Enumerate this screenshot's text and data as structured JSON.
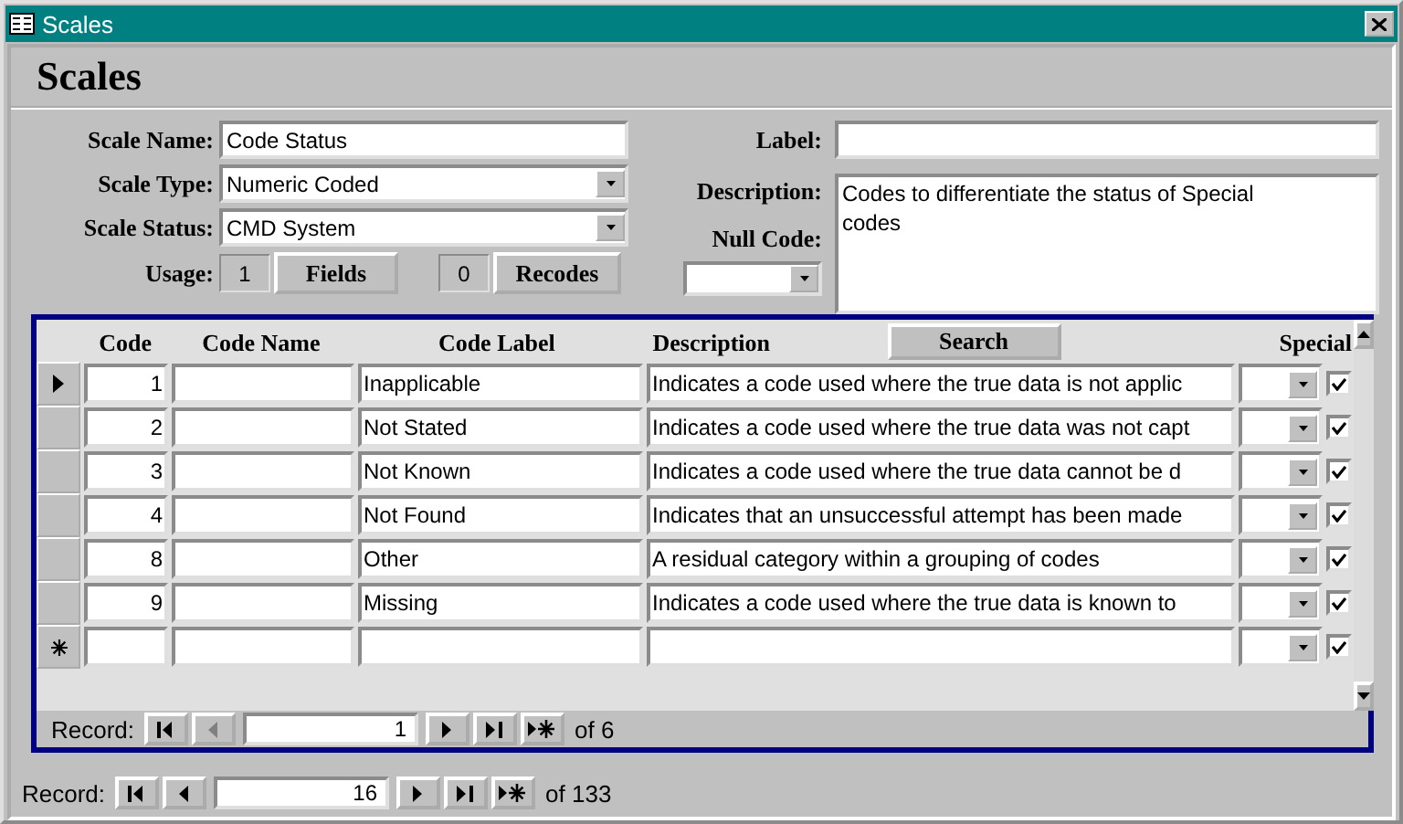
{
  "window": {
    "title": "Scales"
  },
  "header": {
    "title": "Scales"
  },
  "form": {
    "scale_name": {
      "label": "Scale Name:",
      "value": "Code Status"
    },
    "scale_type": {
      "label": "Scale Type:",
      "value": "Numeric Coded"
    },
    "scale_status": {
      "label": "Scale Status:",
      "value": "CMD System"
    },
    "usage": {
      "label": "Usage:",
      "fields_count": "1",
      "fields_button": "Fields",
      "recodes_count": "0",
      "recodes_button": "Recodes"
    },
    "label": {
      "label": "Label:"
    },
    "description": {
      "label": "Description:",
      "value": "Codes to differentiate the status of Special codes"
    },
    "null_code": {
      "label": "Null Code:"
    }
  },
  "subform": {
    "columns": [
      "Code",
      "Code Name",
      "Code Label",
      "Description",
      "Special"
    ],
    "search_button": "Search",
    "rows": [
      {
        "selected": true,
        "code": "1",
        "code_label": "Inapplicable",
        "description": "Indicates a code used where the true data is not applic",
        "special": true
      },
      {
        "selected": false,
        "code": "2",
        "code_label": "Not Stated",
        "description": "Indicates a code used where the true data was not capt",
        "special": true
      },
      {
        "selected": false,
        "code": "3",
        "code_label": "Not Known",
        "description": "Indicates a code used where the true data cannot be d",
        "special": true
      },
      {
        "selected": false,
        "code": "4",
        "code_label": "Not Found",
        "description": "Indicates that an unsuccessful attempt has been made",
        "special": true
      },
      {
        "selected": false,
        "code": "8",
        "code_label": "Other",
        "description": "A residual category within a grouping of codes",
        "special": true
      },
      {
        "selected": false,
        "code": "9",
        "code_label": "Missing",
        "description": "Indicates a code used where the true data is known to",
        "special": true
      }
    ],
    "new_row": {
      "special": true
    },
    "navigator": {
      "label": "Record:",
      "current": "1",
      "total": "of 6",
      "buttons": [
        {
          "kind": "first",
          "disabled": false
        },
        {
          "kind": "prev",
          "disabled": true
        },
        {
          "kind": "next",
          "disabled": false
        },
        {
          "kind": "last",
          "disabled": false
        },
        {
          "kind": "new",
          "disabled": false
        }
      ]
    }
  },
  "navigator": {
    "label": "Record:",
    "current": "16",
    "total": "of 133",
    "buttons": [
      {
        "kind": "first",
        "disabled": false
      },
      {
        "kind": "prev",
        "disabled": false
      },
      {
        "kind": "next",
        "disabled": false
      },
      {
        "kind": "last",
        "disabled": false
      },
      {
        "kind": "new",
        "disabled": false
      }
    ]
  }
}
